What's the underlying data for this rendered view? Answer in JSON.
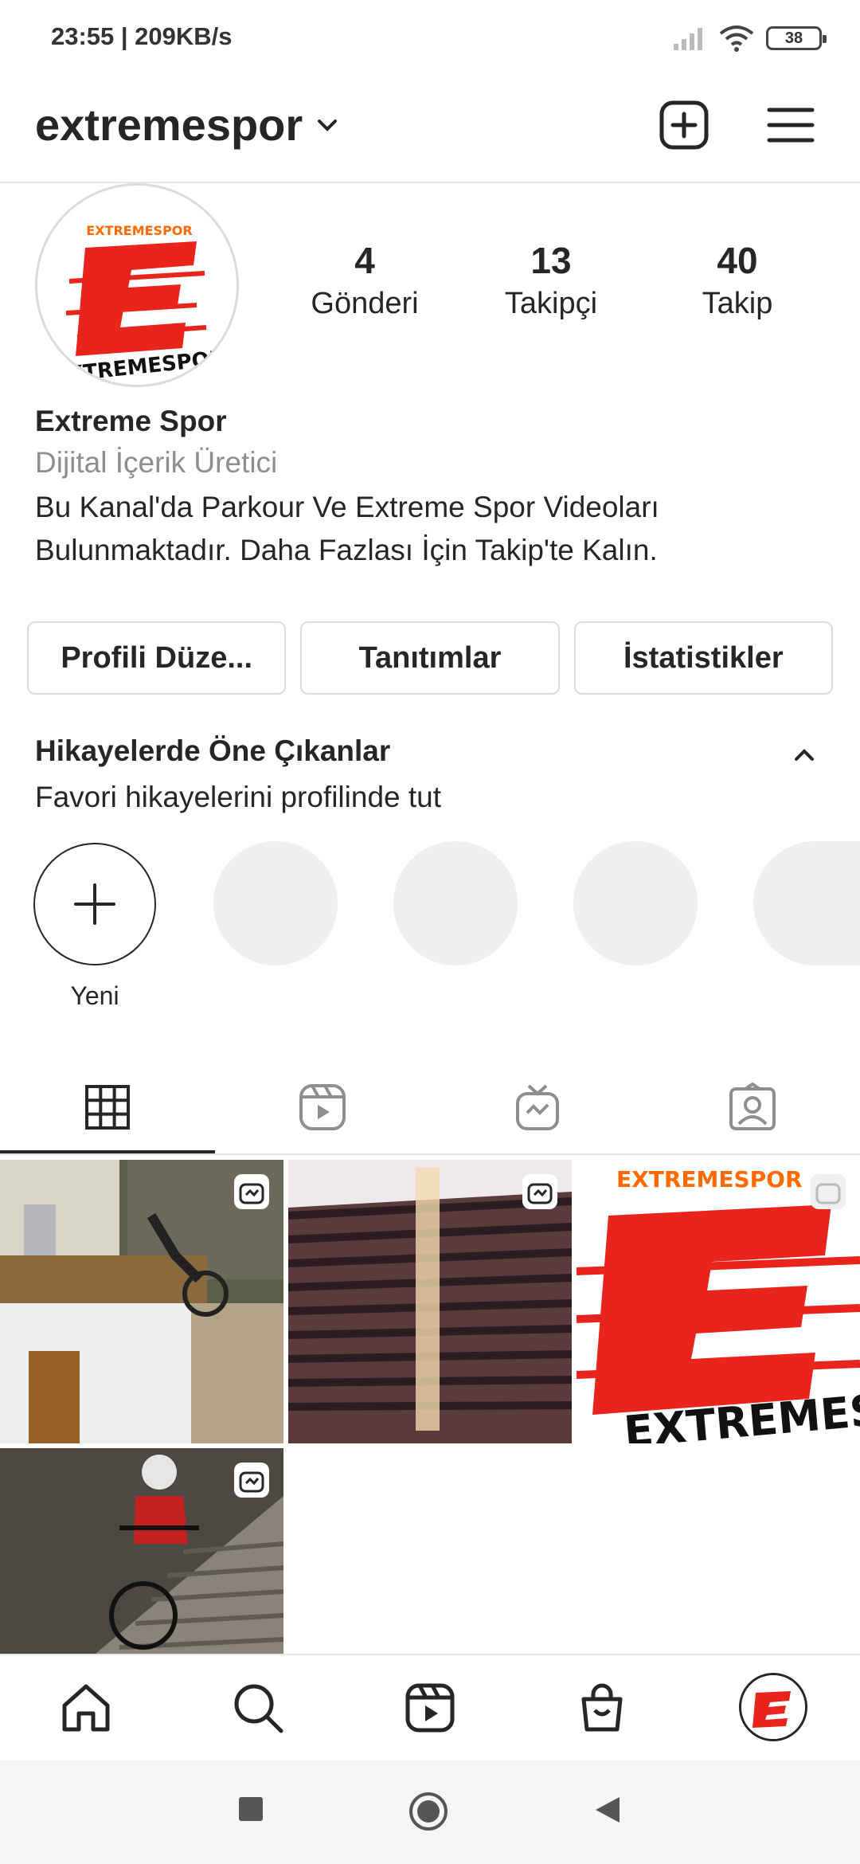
{
  "status": {
    "time": "23:55 | 209KB/s",
    "battery": "38"
  },
  "header": {
    "username": "extremespor",
    "icons": [
      "chevron-down-icon",
      "new-post-icon",
      "menu-icon"
    ]
  },
  "profile": {
    "stats": [
      {
        "value": "4",
        "label": "Gönderi"
      },
      {
        "value": "13",
        "label": "Takipçi"
      },
      {
        "value": "40",
        "label": "Takip"
      }
    ],
    "name": "Extreme Spor",
    "category": "Dijital İçerik Üretici",
    "bio_line1": "Bu Kanal'da Parkour Ve Extreme Spor Videoları",
    "bio_line2": "Bulunmaktadır. Daha Fazlası İçin Takip'te Kalın.",
    "logo_text_top": "EXTREMESPOR",
    "logo_letter": "E",
    "logo_text_bottom": "EXTREMESPOR"
  },
  "buttons": {
    "edit": "Profili Düze...",
    "promotions": "Tanıtımlar",
    "insights": "İstatistikler"
  },
  "highlights": {
    "title": "Hikayelerde Öne Çıkanlar",
    "subtitle": "Favori hikayelerini profilinde tut",
    "new_label": "Yeni"
  },
  "tabs": [
    "grid-icon",
    "reels-icon",
    "igtv-icon",
    "tagged-icon"
  ],
  "posts": [
    {
      "type": "igtv",
      "desc": "bike-on-balcony"
    },
    {
      "type": "igtv",
      "desc": "roof-tiles"
    },
    {
      "type": "igtv",
      "desc": "extremespor-logo"
    },
    {
      "type": "igtv",
      "desc": "bike-on-stairs"
    }
  ],
  "bottom_nav": [
    "home-icon",
    "search-icon",
    "reels-icon",
    "shop-icon",
    "profile-avatar"
  ],
  "colors": {
    "brand_red": "#e8241c",
    "text": "#262626",
    "muted": "#8e8e8e",
    "border": "#dbdbdb"
  }
}
